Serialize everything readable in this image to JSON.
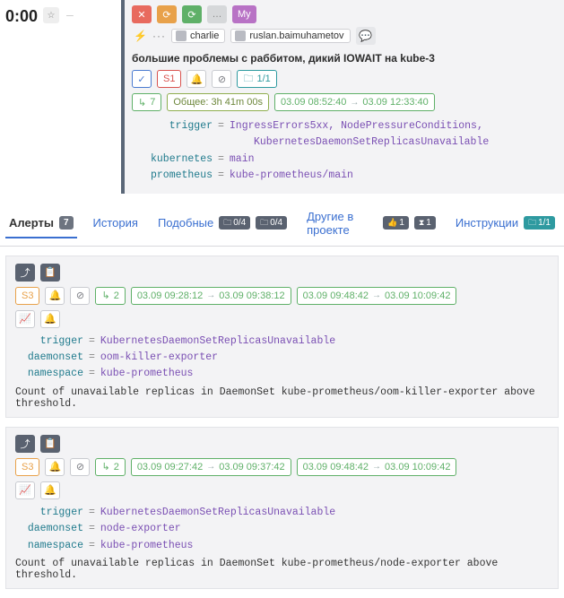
{
  "header": {
    "timer": "0:00",
    "mini_box": "☆",
    "sep": "–",
    "buttons": {
      "red": "✕",
      "orange": "⟳",
      "green": "⟳",
      "grey": "…",
      "my": "My"
    },
    "lightning": "⚡",
    "dots": "···",
    "users": [
      "charlie",
      "ruslan.baimuhametov"
    ],
    "chat_icon": "💬",
    "title": "большие проблемы с раббитом, дикий IOWAIT на kube-3",
    "tags": {
      "check": "✓",
      "severity": "S1",
      "bell": "🔔",
      "muted": "⊘",
      "folder_count": "1/1"
    },
    "row2": {
      "retry_count": "7",
      "total_label": "Общее: 3h 41m 00s",
      "t1_from": "03.09 08:52:40",
      "t1_to": "03.09 12:33:40"
    },
    "kv": {
      "trigger_key": "trigger",
      "trigger_val1": "IngressErrors5xx, NodePressureConditions,",
      "trigger_val2": "KubernetesDaemonSetReplicasUnavailable",
      "kubernetes_key": "kubernetes",
      "kubernetes_val": "main",
      "prometheus_key": "prometheus",
      "prometheus_val": "kube-prometheus/main"
    }
  },
  "tabs": {
    "alerts": "Алерты",
    "alerts_count": "7",
    "history": "История",
    "similar": "Подобные",
    "similar_b1": "0/4",
    "similar_b2": "0/4",
    "others": "Другие в проекте",
    "others_b1": "1",
    "others_b2": "1",
    "instructions": "Инструкции",
    "instructions_b": "1/1"
  },
  "alerts": [
    {
      "top_icons": [
        "⤴",
        "📋"
      ],
      "severity": "S3",
      "bell": "🔔",
      "mute": "⊘",
      "retry": "2",
      "t1_from": "03.09 09:28:12",
      "t1_to": "03.09 09:38:12",
      "t2_from": "03.09 09:48:42",
      "t2_to": "03.09 10:09:42",
      "icons2": [
        "📈",
        "🔔"
      ],
      "kv": {
        "trigger_key": "trigger",
        "trigger_val": "KubernetesDaemonSetReplicasUnavailable",
        "daemonset_key": "daemonset",
        "daemonset_val": "oom-killer-exporter",
        "namespace_key": "namespace",
        "namespace_val": "kube-prometheus"
      },
      "desc": "Count of unavailable replicas in DaemonSet kube-prometheus/oom-killer-exporter above threshold."
    },
    {
      "top_icons": [
        "⤴",
        "📋"
      ],
      "severity": "S3",
      "bell": "🔔",
      "mute": "⊘",
      "retry": "2",
      "t1_from": "03.09 09:27:42",
      "t1_to": "03.09 09:37:42",
      "t2_from": "03.09 09:48:42",
      "t2_to": "03.09 10:09:42",
      "icons2": [
        "📈",
        "🔔"
      ],
      "kv": {
        "trigger_key": "trigger",
        "trigger_val": "KubernetesDaemonSetReplicasUnavailable",
        "daemonset_key": "daemonset",
        "daemonset_val": "node-exporter",
        "namespace_key": "namespace",
        "namespace_val": "kube-prometheus"
      },
      "desc": "Count of unavailable replicas in DaemonSet kube-prometheus/node-exporter above threshold."
    }
  ]
}
